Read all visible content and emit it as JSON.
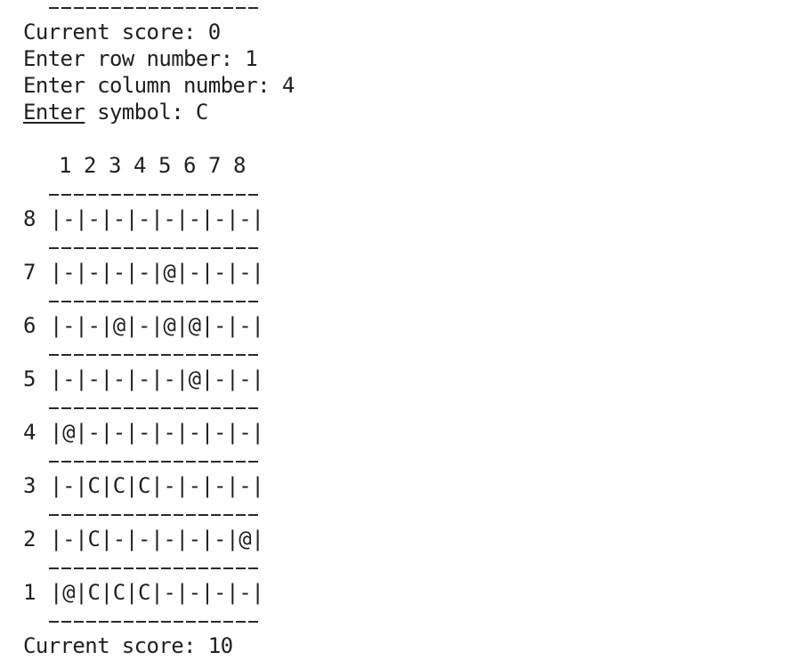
{
  "console": {
    "before": [
      {
        "prefix": "",
        "text": "Current score: 0"
      },
      {
        "prefix": "",
        "text": "Enter row number: 1"
      },
      {
        "prefix": "",
        "text": "Enter column number: 4"
      },
      {
        "prefix": "Enter",
        "text": " symbol: C"
      }
    ],
    "after": "Current score: 10"
  },
  "board": {
    "columns": [
      "1",
      "2",
      "3",
      "4",
      "5",
      "6",
      "7",
      "8"
    ],
    "rows": [
      {
        "label": "8",
        "line": "|-|-|-|-|-|-|-|-|"
      },
      {
        "label": "7",
        "line": "|-|-|-|-|@|-|-|-|"
      },
      {
        "label": "6",
        "line": "|-|-|@|-|@|@|-|-|"
      },
      {
        "label": "5",
        "line": "|-|-|-|-|-|@|-|-|"
      },
      {
        "label": "4",
        "line": "|@|-|-|-|-|-|-|-|"
      },
      {
        "label": "3",
        "line": "|-|C|C|C|-|-|-|-|"
      },
      {
        "label": "2",
        "line": "|-|C|-|-|-|-|-|@|"
      },
      {
        "label": "1",
        "line": "|@|C|C|C|-|-|-|-|"
      }
    ]
  }
}
